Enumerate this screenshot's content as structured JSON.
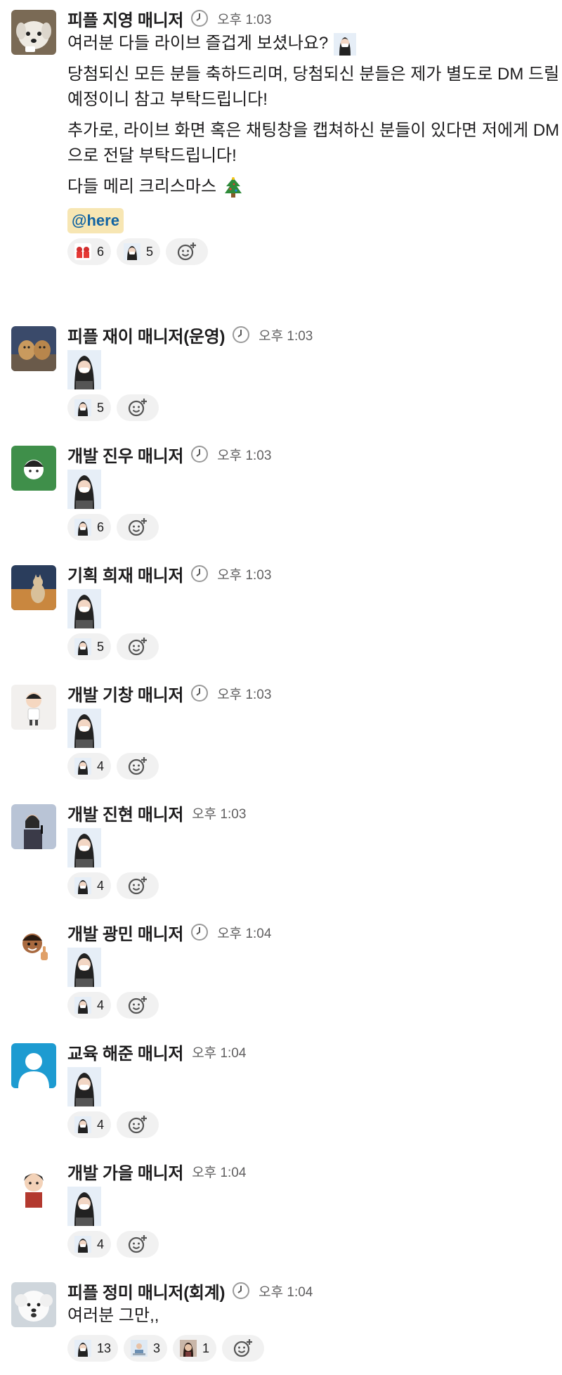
{
  "messages": [
    {
      "name": "피플 지영 매니저",
      "time": "오후 1:03",
      "status_icon": "clock-icon",
      "avatar": "white-dog-avatar",
      "lines": [
        "여러분 다들 라이브 즐겁게 보셨나요?",
        "당첨되신 모든 분들 축하드리며, 당첨되신 분들은 제가 별도로 DM 드릴 예정이니 참고 부탁드립니다!",
        "추가로, 라이브 화면 혹은 채팅창을 캡쳐하신 분들이 있다면 저에게 DM으로 전달 부탁드립니다!",
        "다들 메리 크리스마스"
      ],
      "mention": "@here",
      "reactions": [
        {
          "icon": "red-characters-emoji",
          "count": "6"
        },
        {
          "icon": "masked-girl-emoji",
          "count": "5"
        }
      ]
    },
    {
      "name": "피플 재이 매니저(운영)",
      "time": "오후 1:03",
      "status_icon": "clock-icon",
      "avatar": "two-dogs-avatar",
      "reactions": [
        {
          "icon": "masked-girl-emoji",
          "count": "5"
        }
      ]
    },
    {
      "name": "개발 진우 매니저",
      "time": "오후 1:03",
      "status_icon": "clock-icon",
      "avatar": "green-cartoon-avatar",
      "reactions": [
        {
          "icon": "masked-girl-emoji",
          "count": "6"
        }
      ]
    },
    {
      "name": "기획 희재 매니저",
      "time": "오후 1:03",
      "status_icon": "clock-icon",
      "avatar": "sunset-cat-avatar",
      "reactions": [
        {
          "icon": "masked-girl-emoji",
          "count": "5"
        }
      ]
    },
    {
      "name": "개발 기창 매니저",
      "time": "오후 1:03",
      "status_icon": "clock-icon",
      "avatar": "chibi-man-avatar",
      "reactions": [
        {
          "icon": "masked-girl-emoji",
          "count": "4"
        }
      ]
    },
    {
      "name": "개발 진현 매니저",
      "time": "오후 1:03",
      "status_icon": "",
      "avatar": "speaker-photo-avatar",
      "reactions": [
        {
          "icon": "masked-girl-emoji",
          "count": "4"
        }
      ]
    },
    {
      "name": "개발 광민 매니저",
      "time": "오후 1:04",
      "status_icon": "clock-icon",
      "avatar": "memoji-thumbs-avatar",
      "reactions": [
        {
          "icon": "masked-girl-emoji",
          "count": "4"
        }
      ]
    },
    {
      "name": "교육 해준 매니저",
      "time": "오후 1:04",
      "status_icon": "",
      "avatar": "default-user-avatar",
      "reactions": [
        {
          "icon": "masked-girl-emoji",
          "count": "4"
        }
      ]
    },
    {
      "name": "개발 가을 매니저",
      "time": "오후 1:04",
      "status_icon": "",
      "avatar": "cartoon-boy-avatar",
      "reactions": [
        {
          "icon": "masked-girl-emoji",
          "count": "4"
        }
      ]
    },
    {
      "name": "피플 정미 매니저(회계)",
      "time": "오후 1:04",
      "status_icon": "clock-icon",
      "avatar": "fluffy-dog-avatar",
      "lines": [
        "여러분 그만,,"
      ],
      "reactions": [
        {
          "icon": "masked-girl-emoji",
          "count": "13"
        },
        {
          "icon": "desk-person-emoji",
          "count": "3"
        },
        {
          "icon": "dark-hair-emoji",
          "count": "1"
        }
      ]
    }
  ]
}
